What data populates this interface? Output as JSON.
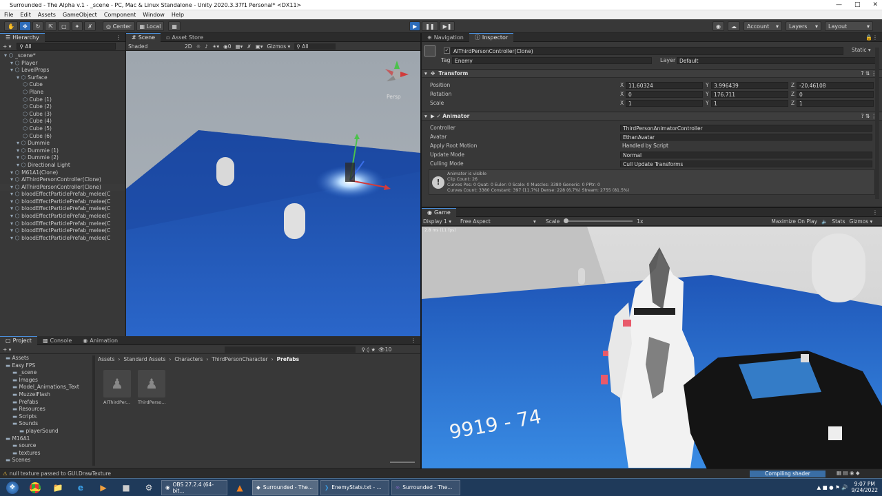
{
  "window": {
    "title": "Surrounded - The Alpha v.1 - _scene - PC, Mac & Linux Standalone - Unity 2020.3.37f1 Personal* <DX11>"
  },
  "menu": [
    "File",
    "Edit",
    "Assets",
    "GameObject",
    "Component",
    "Window",
    "Help"
  ],
  "toolbar": {
    "center": "Center",
    "local": "Local",
    "account": "Account",
    "layers": "Layers",
    "layout": "Layout"
  },
  "hierarchy": {
    "tab": "Hierarchy",
    "search": "All",
    "items": [
      {
        "label": "_scene*",
        "indent": 0,
        "selected": false
      },
      {
        "label": "Player",
        "indent": 1,
        "selected": false
      },
      {
        "label": "LevelProps",
        "indent": 1,
        "selected": false
      },
      {
        "label": "Surface",
        "indent": 2,
        "selected": false
      },
      {
        "label": "Cube",
        "indent": 3,
        "selected": false
      },
      {
        "label": "Plane",
        "indent": 3,
        "selected": false
      },
      {
        "label": "Cube (1)",
        "indent": 3,
        "selected": false
      },
      {
        "label": "Cube (2)",
        "indent": 3,
        "selected": false
      },
      {
        "label": "Cube (3)",
        "indent": 3,
        "selected": false
      },
      {
        "label": "Cube (4)",
        "indent": 3,
        "selected": false
      },
      {
        "label": "Cube (5)",
        "indent": 3,
        "selected": false
      },
      {
        "label": "Cube (6)",
        "indent": 3,
        "selected": false
      },
      {
        "label": "Dummie",
        "indent": 2,
        "selected": false
      },
      {
        "label": "Dummie (1)",
        "indent": 2,
        "selected": false
      },
      {
        "label": "Dummie (2)",
        "indent": 2,
        "selected": false
      },
      {
        "label": "Directional Light",
        "indent": 2,
        "selected": false
      },
      {
        "label": "M61A1(Clone)",
        "indent": 1,
        "selected": false
      },
      {
        "label": "AIThirdPersonController(Clone)",
        "indent": 1,
        "selected": false
      },
      {
        "label": "AIThirdPersonController(Clone)",
        "indent": 1,
        "selected": true
      },
      {
        "label": "bloodEffectParticlePrefab_melee(C",
        "indent": 1,
        "selected": false
      },
      {
        "label": "bloodEffectParticlePrefab_melee(C",
        "indent": 1,
        "selected": false
      },
      {
        "label": "bloodEffectParticlePrefab_melee(C",
        "indent": 1,
        "selected": false
      },
      {
        "label": "bloodEffectParticlePrefab_melee(C",
        "indent": 1,
        "selected": false
      },
      {
        "label": "bloodEffectParticlePrefab_melee(C",
        "indent": 1,
        "selected": false
      },
      {
        "label": "bloodEffectParticlePrefab_melee(C",
        "indent": 1,
        "selected": false
      },
      {
        "label": "bloodEffectParticlePrefab_melee(C",
        "indent": 1,
        "selected": false
      }
    ]
  },
  "scene": {
    "tabs": [
      "Scene",
      "Asset Store"
    ],
    "shading": "Shaded",
    "mode2d": "2D",
    "gizmos": "Gizmos",
    "search": "All",
    "persp": "Persp",
    "counter": "0"
  },
  "inspector": {
    "tabs": [
      "Navigation",
      "Inspector"
    ],
    "object_name": "AIThirdPersonController(Clone)",
    "static_label": "Static",
    "tag_label": "Tag",
    "tag_value": "Enemy",
    "layer_label": "Layer",
    "layer_value": "Default",
    "transform": {
      "title": "Transform",
      "rows": [
        {
          "label": "Position",
          "x": "11.60324",
          "y": "3.996439",
          "z": "-20.46108"
        },
        {
          "label": "Rotation",
          "x": "0",
          "y": "176.711",
          "z": "0"
        },
        {
          "label": "Scale",
          "x": "1",
          "y": "1",
          "z": "1"
        }
      ]
    },
    "animator": {
      "title": "Animator",
      "rows": [
        {
          "label": "Controller",
          "value": "ThirdPersonAnimatorController"
        },
        {
          "label": "Avatar",
          "value": "EthanAvatar"
        },
        {
          "label": "Apply Root Motion",
          "value": "Handled by Script"
        },
        {
          "label": "Update Mode",
          "value": "Normal"
        },
        {
          "label": "Culling Mode",
          "value": "Cull Update Transforms"
        }
      ],
      "info": [
        "Animator is visible",
        "Clip Count: 26",
        "Curves Pos: 0 Quat: 0 Euler: 0 Scale: 0 Muscles: 3380 Generic: 0 PPtr: 0",
        "Curves Count: 3380 Constant: 397 (11.7%) Dense: 228 (6.7%) Stream: 2755 (81.5%)"
      ]
    }
  },
  "game": {
    "tab": "Game",
    "display": "Display 1",
    "aspect": "Free Aspect",
    "scale_label": "Scale",
    "scale_value": "1x",
    "maximize": "Maximize On Play",
    "stats": "Stats",
    "gizmos": "Gizmos",
    "fps": "2.8 ms (11 fps)",
    "score": "9919 - 74"
  },
  "project": {
    "tabs": [
      "Project",
      "Console",
      "Animation"
    ],
    "count": "10",
    "breadcrumb": [
      "Assets",
      "Standard Assets",
      "Characters",
      "ThirdPersonCharacter",
      "Prefabs"
    ],
    "tree": [
      {
        "label": "Assets",
        "indent": 0
      },
      {
        "label": "Easy FPS",
        "indent": 0
      },
      {
        "label": "_scene",
        "indent": 1
      },
      {
        "label": "Images",
        "indent": 1
      },
      {
        "label": "Model_Animations_Text",
        "indent": 1
      },
      {
        "label": "MuzzelFlash",
        "indent": 1
      },
      {
        "label": "Prefabs",
        "indent": 1
      },
      {
        "label": "Resources",
        "indent": 1
      },
      {
        "label": "Scripts",
        "indent": 1
      },
      {
        "label": "Sounds",
        "indent": 1
      },
      {
        "label": "playerSound",
        "indent": 2
      },
      {
        "label": "M16A1",
        "indent": 0
      },
      {
        "label": "source",
        "indent": 1
      },
      {
        "label": "textures",
        "indent": 1
      },
      {
        "label": "Scenes",
        "indent": 0
      },
      {
        "label": "Standard Assets",
        "indent": 0
      }
    ],
    "assets": [
      {
        "label": "AIThirdPer..."
      },
      {
        "label": "ThirdPerso..."
      }
    ]
  },
  "status": {
    "message": "null texture passed to GUI.DrawTexture",
    "progress": "Compiling shader"
  },
  "taskbar": {
    "items": [
      "OBS 27.2.4 (64-bit...",
      "Surrounded - The...",
      "EnemyStats.txt - ...",
      "Surrounded - The..."
    ],
    "time": "9:07 PM",
    "date": "9/24/2022"
  },
  "colors": {
    "play_active": "#2d6cba",
    "scene_floor": "#1d4fa8",
    "game_floor": "#2a64c8"
  }
}
